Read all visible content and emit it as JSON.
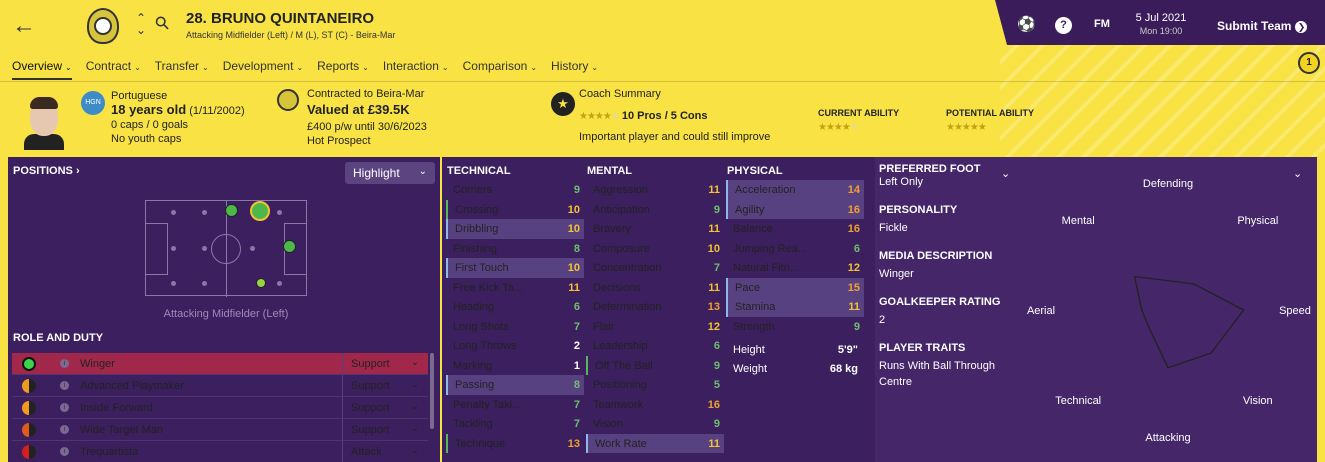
{
  "header": {
    "shirt_number_name": "28. BRUNO QUINTANEIRO",
    "positions_club": "Attacking Midfielder (Left) / M (L), ST (C) - Beira-Mar"
  },
  "topbar": {
    "fm_label": "FM",
    "date": "5 Jul 2021",
    "time": "Mon 19:00",
    "submit_label": "Submit Team",
    "notification_count": "1"
  },
  "tabs": [
    "Overview",
    "Contract",
    "Transfer",
    "Development",
    "Reports",
    "Interaction",
    "Comparison",
    "History"
  ],
  "bio": {
    "nationality": "Portuguese",
    "age": "18 years old",
    "dob": "(1/11/2002)",
    "caps": "0 caps / 0 goals",
    "youth_caps": "No youth caps",
    "flag_code": "HGN"
  },
  "contract": {
    "contracted": "Contracted to Beira-Mar",
    "value": "Valued at £39.5K",
    "wage": "£400 p/w until 30/6/2023",
    "status": "Hot Prospect"
  },
  "coach": {
    "title": "Coach Summary",
    "pros_cons": "10 Pros / 5 Cons",
    "summary": "Important player and could still improve",
    "current_ability_label": "CURRENT ABILITY",
    "current_ability_stars": 3.5,
    "potential_ability_label": "POTENTIAL ABILITY",
    "potential_ability_stars": 5
  },
  "positions": {
    "title": "POSITIONS",
    "highlight": "Highlight",
    "pitch_caption": "Attacking Midfielder (Left)"
  },
  "role_duty": {
    "title": "ROLE AND DUTY",
    "roles": [
      {
        "name": "Winger",
        "duty": "Support",
        "color": "#3bd44a",
        "selected": true
      },
      {
        "name": "Advanced Playmaker",
        "duty": "Support",
        "color": "#f09a20"
      },
      {
        "name": "Inside Forward",
        "duty": "Support",
        "color": "#f09a20"
      },
      {
        "name": "Wide Target Man",
        "duty": "Support",
        "color": "#e05a20"
      },
      {
        "name": "Trequartista",
        "duty": "Attack",
        "color": "#d02020"
      }
    ]
  },
  "technical": {
    "title": "TECHNICAL",
    "attrs": [
      {
        "name": "Corners",
        "value": "9"
      },
      {
        "name": "Crossing",
        "value": "10",
        "hl": "gb"
      },
      {
        "name": "Dribbling",
        "value": "10",
        "hl": "hi"
      },
      {
        "name": "Finishing",
        "value": "8"
      },
      {
        "name": "First Touch",
        "value": "10",
        "hl": "hi"
      },
      {
        "name": "Free Kick Ta...",
        "value": "11"
      },
      {
        "name": "Heading",
        "value": "6"
      },
      {
        "name": "Long Shots",
        "value": "7"
      },
      {
        "name": "Long Throws",
        "value": "2"
      },
      {
        "name": "Marking",
        "value": "1"
      },
      {
        "name": "Passing",
        "value": "8",
        "hl": "hi"
      },
      {
        "name": "Penalty Taki...",
        "value": "7"
      },
      {
        "name": "Tackling",
        "value": "7"
      },
      {
        "name": "Technique",
        "value": "13",
        "hl": "gb"
      }
    ]
  },
  "mental": {
    "title": "MENTAL",
    "attrs": [
      {
        "name": "Aggression",
        "value": "11"
      },
      {
        "name": "Anticipation",
        "value": "9"
      },
      {
        "name": "Bravery",
        "value": "11"
      },
      {
        "name": "Composure",
        "value": "10"
      },
      {
        "name": "Concentration",
        "value": "7"
      },
      {
        "name": "Decisions",
        "value": "11"
      },
      {
        "name": "Determination",
        "value": "13"
      },
      {
        "name": "Flair",
        "value": "12"
      },
      {
        "name": "Leadership",
        "value": "6"
      },
      {
        "name": "Off The Ball",
        "value": "9",
        "hl": "gb"
      },
      {
        "name": "Positioning",
        "value": "5"
      },
      {
        "name": "Teamwork",
        "value": "16"
      },
      {
        "name": "Vision",
        "value": "9"
      },
      {
        "name": "Work Rate",
        "value": "11",
        "hl": "hi"
      }
    ]
  },
  "physical": {
    "title": "PHYSICAL",
    "attrs": [
      {
        "name": "Acceleration",
        "value": "14",
        "hl": "hi"
      },
      {
        "name": "Agility",
        "value": "16",
        "hl": "hi"
      },
      {
        "name": "Balance",
        "value": "16"
      },
      {
        "name": "Jumping Rea...",
        "value": "6"
      },
      {
        "name": "Natural Fitn...",
        "value": "12"
      },
      {
        "name": "Pace",
        "value": "15",
        "hl": "hi"
      },
      {
        "name": "Stamina",
        "value": "11",
        "hl": "hi"
      },
      {
        "name": "Strength",
        "value": "9"
      }
    ],
    "height_label": "Height",
    "height": "5'9\"",
    "weight_label": "Weight",
    "weight": "68 kg"
  },
  "profile": {
    "preferred_foot_label": "PREFERRED FOOT",
    "preferred_foot": "Left Only",
    "personality_label": "PERSONALITY",
    "personality": "Fickle",
    "media_label": "MEDIA DESCRIPTION",
    "media": "Winger",
    "gk_label": "GOALKEEPER RATING",
    "gk": "2",
    "traits_label": "PLAYER TRAITS",
    "traits": "Runs With Ball Through Centre"
  },
  "radar": {
    "axes": [
      "Defending",
      "Physical",
      "Speed",
      "Vision",
      "Attacking",
      "Technical",
      "Aerial",
      "Mental"
    ],
    "values": [
      0.28,
      0.35,
      0.72,
      0.58,
      0.55,
      0.25,
      0.25,
      0.45
    ]
  }
}
